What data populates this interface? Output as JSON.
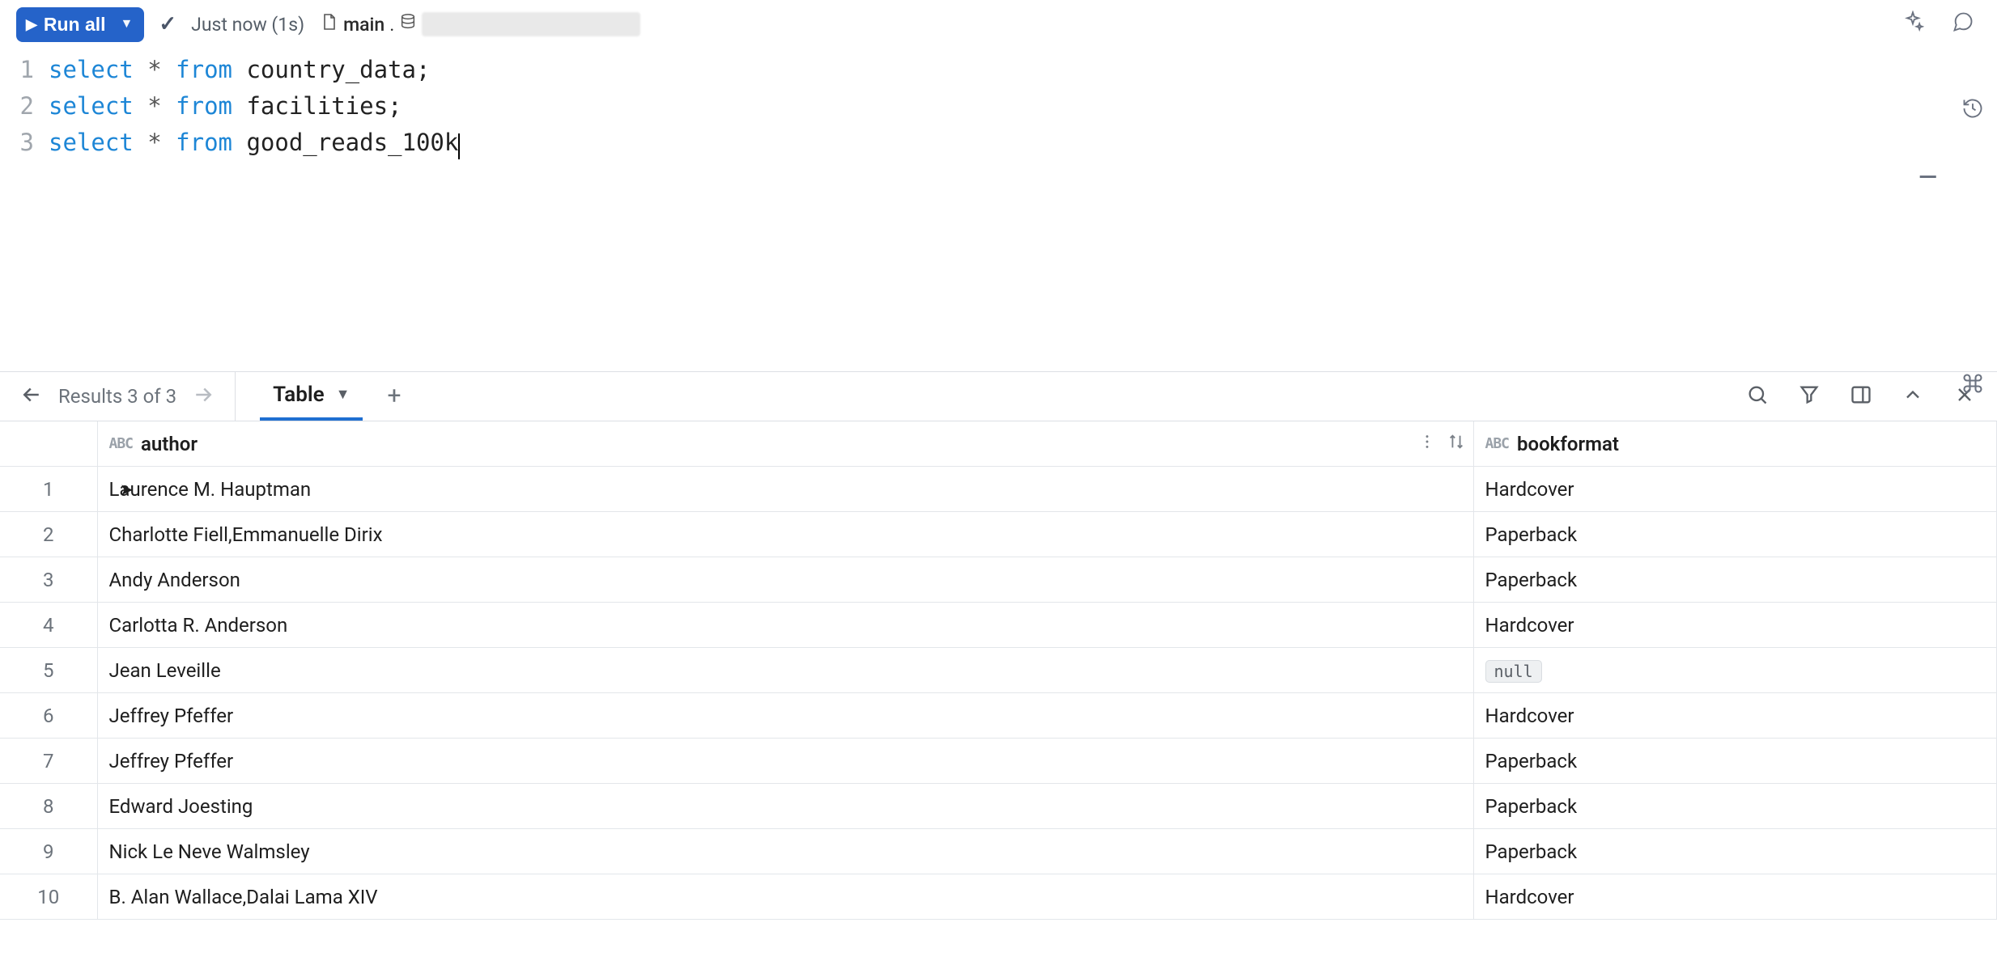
{
  "toolbar": {
    "run_label": "Run all",
    "status": "Just now (1s)",
    "context_main": "main",
    "context_sep": "."
  },
  "editor": {
    "lines": [
      {
        "n": "1",
        "kw1": "select",
        "op": " * ",
        "kw2": "from",
        "rest": " country_data;"
      },
      {
        "n": "2",
        "kw1": "select",
        "op": " * ",
        "kw2": "from",
        "rest": " facilities;"
      },
      {
        "n": "3",
        "kw1": "select",
        "op": " * ",
        "kw2": "from",
        "rest": " good_reads_100k"
      }
    ]
  },
  "results": {
    "nav_label": "Results 3 of 3",
    "tab_label": "Table",
    "columns": [
      {
        "name": "author",
        "type": "ABC"
      },
      {
        "name": "bookformat",
        "type": "ABC"
      }
    ],
    "rows": [
      {
        "n": "1",
        "author": "Laurence M. Hauptman",
        "bookformat": "Hardcover"
      },
      {
        "n": "2",
        "author": "Charlotte Fiell,Emmanuelle Dirix",
        "bookformat": "Paperback"
      },
      {
        "n": "3",
        "author": "Andy Anderson",
        "bookformat": "Paperback"
      },
      {
        "n": "4",
        "author": "Carlotta R. Anderson",
        "bookformat": "Hardcover"
      },
      {
        "n": "5",
        "author": "Jean Leveille",
        "bookformat": null
      },
      {
        "n": "6",
        "author": "Jeffrey Pfeffer",
        "bookformat": "Hardcover"
      },
      {
        "n": "7",
        "author": "Jeffrey Pfeffer",
        "bookformat": "Paperback"
      },
      {
        "n": "8",
        "author": "Edward Joesting",
        "bookformat": "Paperback"
      },
      {
        "n": "9",
        "author": "Nick Le Neve Walmsley",
        "bookformat": "Paperback"
      },
      {
        "n": "10",
        "author": "B. Alan Wallace,Dalai Lama XIV",
        "bookformat": "Hardcover"
      }
    ],
    "null_label": "null"
  }
}
